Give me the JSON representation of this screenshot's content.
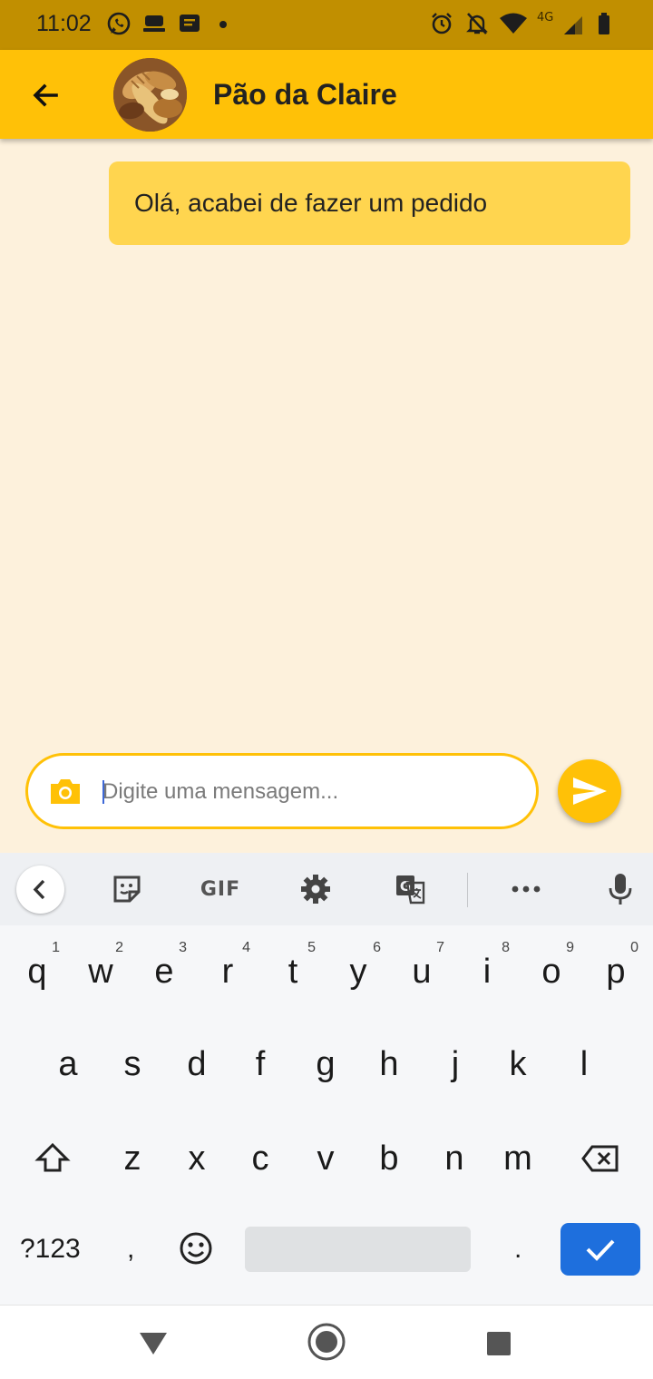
{
  "status_bar": {
    "time": "11:02",
    "network_label": "4G",
    "left_icons": [
      "whatsapp-icon",
      "stack-icon",
      "message-icon",
      "dot-icon"
    ],
    "right_icons": [
      "alarm-icon",
      "notifications-off-icon",
      "wifi-icon",
      "signal-icon",
      "battery-icon"
    ]
  },
  "app_bar": {
    "back_icon": "arrow-back-icon",
    "title": "Pão da Claire",
    "avatar_alt": "bread-avatar",
    "color": "#ffc107"
  },
  "chat": {
    "messages": [
      {
        "text": "Olá, acabei de fazer um pedido",
        "sender": "me"
      }
    ],
    "input_placeholder": "Digite uma mensagem...",
    "input_value": "",
    "camera_icon": "camera-icon",
    "send_icon": "send-icon",
    "background": "#fdf1dc",
    "bubble_color": "#ffd54f"
  },
  "keyboard": {
    "toolbar": [
      "chevron-left-icon",
      "sticker-icon",
      "GIF",
      "gear-icon",
      "translate-icon",
      "more-icon",
      "mic-icon"
    ],
    "gif_label": "GIF",
    "row1": [
      "q",
      "w",
      "e",
      "r",
      "t",
      "y",
      "u",
      "i",
      "o",
      "p"
    ],
    "row1_hints": [
      "1",
      "2",
      "3",
      "4",
      "5",
      "6",
      "7",
      "8",
      "9",
      "0"
    ],
    "row2": [
      "a",
      "s",
      "d",
      "f",
      "g",
      "h",
      "j",
      "k",
      "l"
    ],
    "row3": [
      "z",
      "x",
      "c",
      "v",
      "b",
      "n",
      "m"
    ],
    "symbols_label": "?123",
    "comma_label": ",",
    "period_label": ".",
    "enter_color": "#1e6fdd"
  },
  "nav_bar": [
    "back-triangle-icon",
    "home-circle-icon",
    "recents-square-icon"
  ]
}
